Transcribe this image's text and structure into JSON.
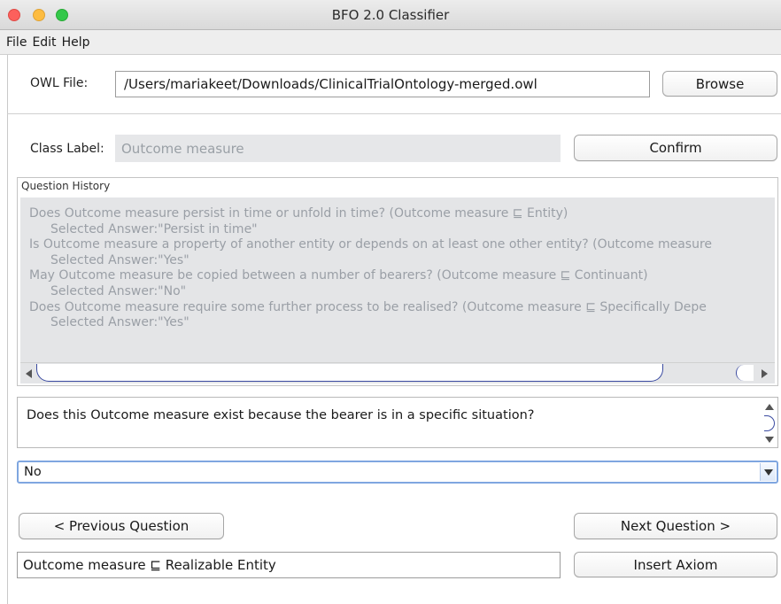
{
  "window": {
    "title": "BFO 2.0 Classifier"
  },
  "menu": {
    "items": [
      "File",
      "Edit",
      "Help"
    ]
  },
  "owl_file": {
    "label": "OWL File:",
    "value": "/Users/mariakeet/Downloads/ClinicalTrialOntology-merged.owl",
    "browse_label": "Browse"
  },
  "class_label": {
    "label": "Class Label:",
    "value": "Outcome measure",
    "confirm_label": "Confirm"
  },
  "history": {
    "title": "Question History",
    "entries": [
      {
        "question": "Does Outcome measure persist in time or unfold in time? (Outcome measure ⊑ Entity)",
        "answer": "Selected Answer:\"Persist in time\""
      },
      {
        "question": "Is Outcome measure a property of another entity or depends on at least one other entity? (Outcome measure",
        "answer": "Selected Answer:\"Yes\""
      },
      {
        "question": "May Outcome measure be copied between a number of bearers? (Outcome measure ⊑ Continuant)",
        "answer": "Selected Answer:\"No\""
      },
      {
        "question": "Does Outcome measure require some further process to be realised? (Outcome measure ⊑ Specifically Depe",
        "answer": "Selected Answer:\"Yes\""
      }
    ]
  },
  "current_question": "Does this Outcome measure exist because the bearer is in a specific situation?",
  "answer_select": {
    "selected": "No"
  },
  "nav": {
    "previous_label": "< Previous Question",
    "next_label": "Next Question >"
  },
  "axiom": {
    "value": "Outcome measure ⊑ Realizable Entity",
    "insert_label": "Insert Axiom"
  }
}
